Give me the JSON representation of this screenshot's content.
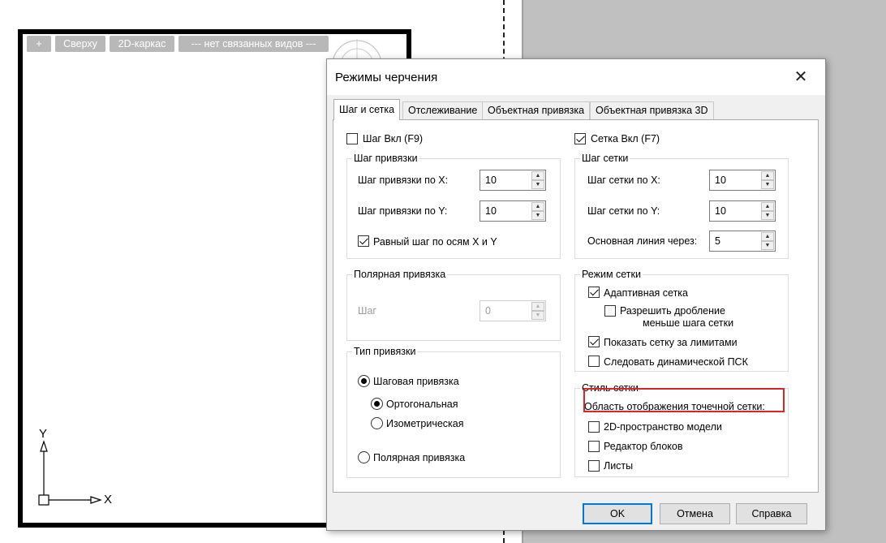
{
  "viewport": {
    "buttons": [
      "+",
      "Сверху",
      "2D-каркас",
      "--- нет связанных видов ---"
    ],
    "ucs_x": "X",
    "ucs_y": "Y"
  },
  "dialog": {
    "title": "Режимы черчения",
    "close_glyph": "✕",
    "tabs": [
      "Шаг и сетка",
      "Отслеживание",
      "Объектная привязка",
      "Объектная привязка 3D"
    ],
    "active_tab": "Шаг и сетка",
    "snap_on": {
      "label": "Шаг Вкл (F9)",
      "checked": false
    },
    "grid_on": {
      "label": "Сетка Вкл (F7)",
      "checked": true
    },
    "snap_spacing": {
      "title": "Шаг привязки",
      "x_label": "Шаг привязки по X:",
      "x_value": "10",
      "y_label": "Шаг привязки по Y:",
      "y_value": "10",
      "equal_label": "Равный шаг по осям X и Y",
      "equal_checked": true
    },
    "polar_spacing": {
      "title": "Полярная привязка",
      "step_label": "Шаг",
      "step_value": "0"
    },
    "snap_type": {
      "title": "Тип привязки",
      "grid_snap": "Шаговая привязка",
      "rectangular": "Ортогональная",
      "isometric": "Изометрическая",
      "polar": "Полярная привязка"
    },
    "grid_spacing": {
      "title": "Шаг сетки",
      "x_label": "Шаг сетки по X:",
      "x_value": "10",
      "y_label": "Шаг сетки по Y:",
      "y_value": "10",
      "major_label": "Основная линия через:",
      "major_value": "5"
    },
    "grid_behavior": {
      "title": "Режим сетки",
      "adaptive": "Адаптивная сетка",
      "subdivide_line1": "Разрешить дробление",
      "subdivide_line2": "меньше шага сетки",
      "beyond_limits": "Показать сетку за лимитами",
      "follow_ucs": "Следовать динамической ПСК"
    },
    "grid_style": {
      "title": "Стиль сетки",
      "caption": "Область отображения точечной сетки:",
      "model_space": "2D-пространство модели",
      "block_editor": "Редактор блоков",
      "sheets": "Листы"
    },
    "buttons": {
      "ok": "OK",
      "cancel": "Отмена",
      "help": "Справка"
    }
  },
  "colors": {
    "highlight": "#d9262b",
    "accent": "#0078d7"
  }
}
